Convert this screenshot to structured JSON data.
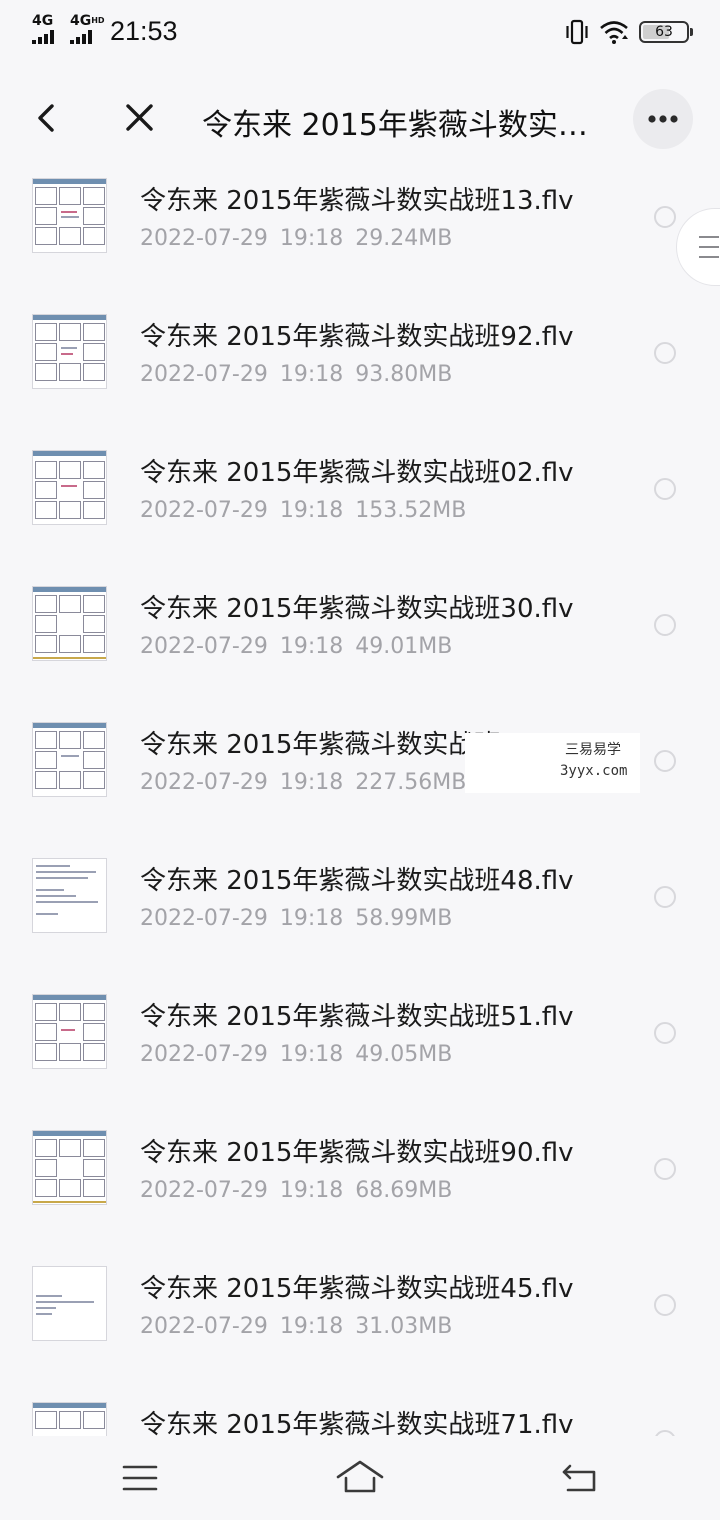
{
  "status_bar": {
    "network_1": "4G",
    "network_2": "4G",
    "network_2_sup": "HD",
    "time": "21:53",
    "battery": "63"
  },
  "header": {
    "title": "令东来 2015年紫薇斗数实…"
  },
  "files": [
    {
      "name": "令东来 2015年紫薇斗数实战班13.flv",
      "date": "2022-07-29",
      "time": "19:18",
      "size": "29.24MB"
    },
    {
      "name": "令东来 2015年紫薇斗数实战班92.flv",
      "date": "2022-07-29",
      "time": "19:18",
      "size": "93.80MB"
    },
    {
      "name": "令东来 2015年紫薇斗数实战班02.flv",
      "date": "2022-07-29",
      "time": "19:18",
      "size": "153.52MB"
    },
    {
      "name": "令东来 2015年紫薇斗数实战班30.flv",
      "date": "2022-07-29",
      "time": "19:18",
      "size": "49.01MB"
    },
    {
      "name": "令东来 2015年紫薇斗数实战班04.flv",
      "date": "2022-07-29",
      "time": "19:18",
      "size": "227.56MB"
    },
    {
      "name": "令东来 2015年紫薇斗数实战班48.flv",
      "date": "2022-07-29",
      "time": "19:18",
      "size": "58.99MB"
    },
    {
      "name": "令东来 2015年紫薇斗数实战班51.flv",
      "date": "2022-07-29",
      "time": "19:18",
      "size": "49.05MB"
    },
    {
      "name": "令东来 2015年紫薇斗数实战班90.flv",
      "date": "2022-07-29",
      "time": "19:18",
      "size": "68.69MB"
    },
    {
      "name": "令东来 2015年紫薇斗数实战班45.flv",
      "date": "2022-07-29",
      "time": "19:18",
      "size": "31.03MB"
    },
    {
      "name": "令东来 2015年紫薇斗数实战班71.flv",
      "date": "",
      "time": "",
      "size": ""
    }
  ],
  "watermark": {
    "line1": "三易易学",
    "line2": "3yyx.com"
  }
}
